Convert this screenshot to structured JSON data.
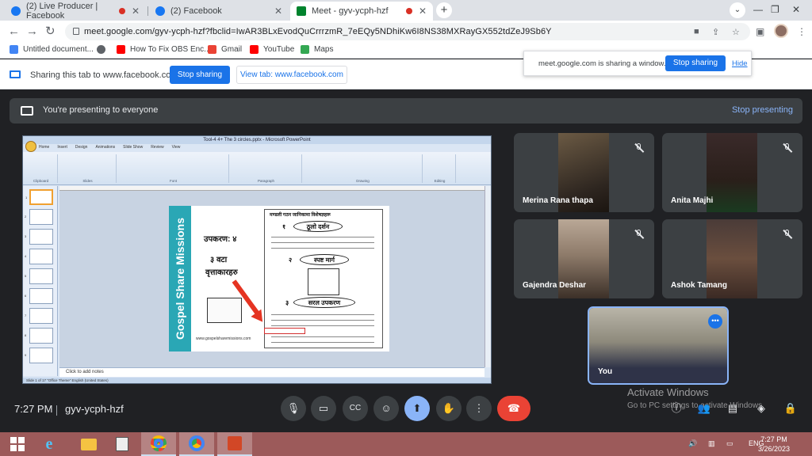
{
  "browser": {
    "tabs": [
      {
        "title": "(2) Live Producer | Facebook",
        "favicon": "facebook-icon",
        "recording": true
      },
      {
        "title": "(2) Facebook",
        "favicon": "facebook-icon",
        "recording": false
      },
      {
        "title": "Meet - gyv-ycph-hzf",
        "favicon": "google-meet-icon",
        "recording": true,
        "active": true
      }
    ],
    "new_tab": "+",
    "url": "meet.google.com/gyv-ycph-hzf?fbclid=IwAR3BLxEvodQuCrrrzmR_7eEQy5NDhiKw6I8NS38MXRayGX552tdZeJ9Sb6Y",
    "bookmarks": [
      {
        "label": "Untitled document...",
        "icon": "google-docs-icon",
        "color": "#4285f4"
      },
      {
        "label": "",
        "icon": "globe-icon",
        "color": "#5f6368"
      },
      {
        "label": "How To Fix OBS Enc...",
        "icon": "youtube-icon",
        "color": "#ff0000"
      },
      {
        "label": "Gmail",
        "icon": "gmail-icon",
        "color": "#ea4335"
      },
      {
        "label": "YouTube",
        "icon": "youtube-icon",
        "color": "#ff0000"
      },
      {
        "label": "Maps",
        "icon": "maps-icon",
        "color": "#34a853"
      }
    ]
  },
  "share_bar": {
    "text": "Sharing this tab to www.facebook.com",
    "stop_label": "Stop sharing",
    "view_label": "View tab: www.facebook.com"
  },
  "share_popup": {
    "text": "meet.google.com is sharing a window.",
    "stop_label": "Stop sharing",
    "hide_label": "Hide"
  },
  "meet": {
    "banner_text": "You're presenting to everyone",
    "stop_presenting": "Stop presenting",
    "time": "7:27 PM",
    "meeting_code": "gyv-ycph-hzf",
    "participants": [
      {
        "name": "Merina Rana thapa",
        "muted": true
      },
      {
        "name": "Anita Majhi",
        "muted": true
      },
      {
        "name": "Gajendra Deshar",
        "muted": true
      },
      {
        "name": "Ashok Tamang",
        "muted": true
      },
      {
        "name": "You",
        "muted": false
      }
    ],
    "watermark_title": "Activate Windows",
    "watermark_sub": "Go to PC settings to activate Windows."
  },
  "powerpoint": {
    "title": "Tool-4 4+ The 3 circles.pptx - Microsoft PowerPoint",
    "ribbon_tabs": [
      "Home",
      "Insert",
      "Design",
      "Animations",
      "Slide Show",
      "Review",
      "View"
    ],
    "ribbon_groups": [
      "Clipboard",
      "Slides",
      "Font",
      "Paragraph",
      "Drawing",
      "Editing"
    ],
    "notes_placeholder": "Click to add notes",
    "status": "Slide 1 of 17    \"Office Theme\"    English (United States)",
    "slide": {
      "vertical_title": "Gospel Share Missions",
      "line1": "उपकरण: ४",
      "line2": "३ वटा",
      "line3": "वृत्ताकारहरु",
      "website": "www.gospelsharemissions.com",
      "doc_header": "मण्डली गठन जानिकामा विशेषज्ञहरू",
      "ovals": [
        "ठूलो दर्शन",
        "स्पष्ट मार्ग",
        "सरल उपकरण"
      ],
      "oval_numbers": [
        "१",
        "२",
        "३"
      ]
    }
  },
  "taskbar": {
    "time": "7:27 PM",
    "date": "3/26/2023",
    "language": "ENG"
  }
}
